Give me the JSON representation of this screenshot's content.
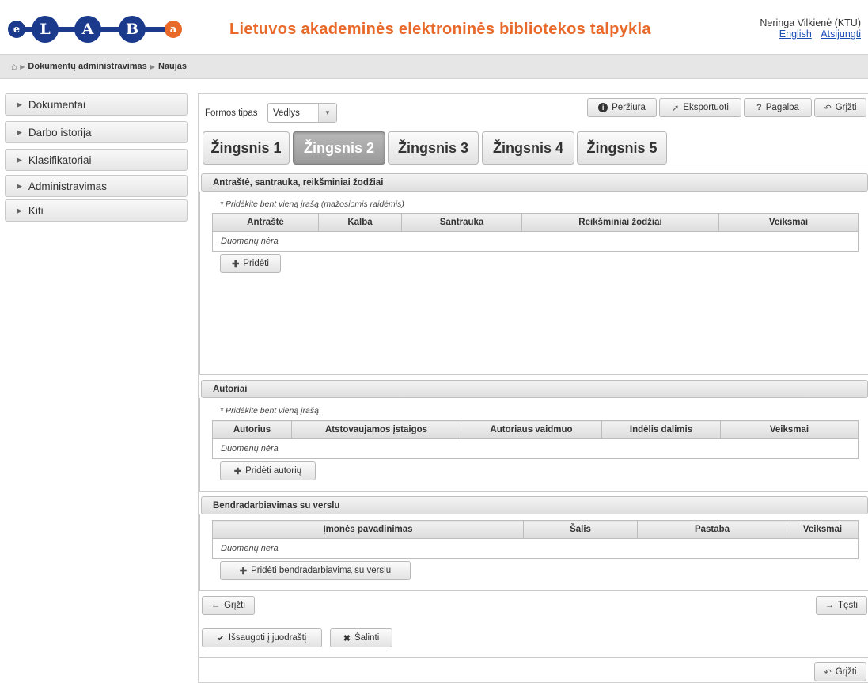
{
  "header": {
    "logo_letters": [
      "e",
      "L",
      "A",
      "B",
      "a"
    ],
    "site_title": "Lietuvos akademinės elektroninės bibliotekos talpykla",
    "user_name": "Neringa Vilkienė (KTU)",
    "link_english": "English",
    "link_logout": "Atsijungti"
  },
  "breadcrumb": {
    "home_icon": "home-icon",
    "items": [
      "Dokumentų administravimas",
      "Naujas"
    ]
  },
  "sidebar": {
    "items": [
      {
        "label": "Dokumentai"
      },
      {
        "label": "Darbo istorija"
      },
      {
        "label": "Klasifikatoriai"
      },
      {
        "label": "Administravimas"
      },
      {
        "label": "Kiti"
      }
    ]
  },
  "toolbar": {
    "form_type_label": "Formos tipas",
    "form_type_value": "Vedlys",
    "preview": "Peržiūra",
    "export": "Eksportuoti",
    "help": "Pagalba",
    "back": "Grįžti"
  },
  "steps": {
    "tabs": [
      "Žingsnis 1",
      "Žingsnis 2",
      "Žingsnis 3",
      "Žingsnis 4",
      "Žingsnis 5"
    ],
    "active_index": 1
  },
  "section_titles": {
    "title": "Antraštė, santrauka, reikšminiai žodžiai",
    "hint": "* Pridėkite bent vieną įrašą (mažosiomis raidėmis)",
    "columns": [
      "Antraštė",
      "Kalba",
      "Santrauka",
      "Reikšminiai žodžiai",
      "Veiksmai"
    ],
    "empty": "Duomenų nėra",
    "add_button": "Pridėti"
  },
  "section_authors": {
    "title": "Autoriai",
    "hint": "* Pridėkite bent vieną įrašą",
    "columns": [
      "Autorius",
      "Atstovaujamos įstaigos",
      "Autoriaus vaidmuo",
      "Indėlis dalimis",
      "Veiksmai"
    ],
    "empty": "Duomenų nėra",
    "add_button": "Pridėti autorių"
  },
  "section_business": {
    "title": "Bendradarbiavimas su verslu",
    "columns": [
      "Įmonės pavadinimas",
      "Šalis",
      "Pastaba",
      "Veiksmai"
    ],
    "empty": "Duomenų nėra",
    "add_button": "Pridėti bendradarbiavimą su verslu"
  },
  "footer": {
    "back": "Grįžti",
    "next": "Tęsti",
    "save_draft": "Išsaugoti į juodraštį",
    "delete": "Šalinti",
    "back_bottom": "Grįžti"
  },
  "colors": {
    "accent_orange": "#e8692a",
    "logo_blue": "#1b3a8c",
    "logo_orange": "#e8692a",
    "link_blue": "#1a4fb5"
  }
}
